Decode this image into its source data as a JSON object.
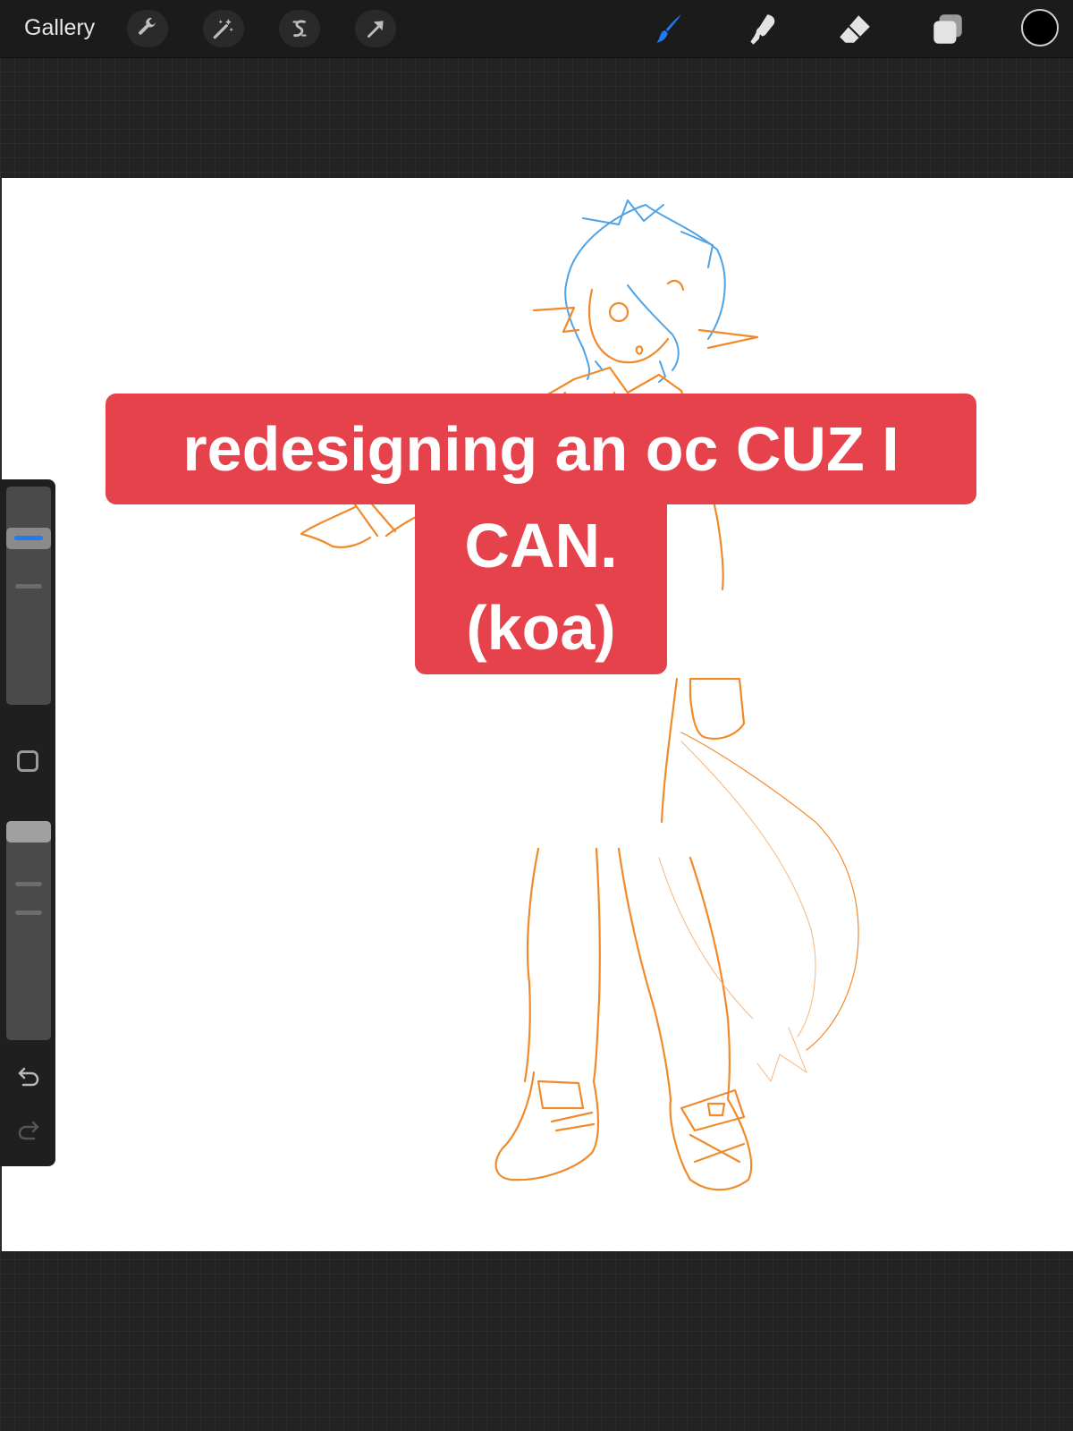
{
  "toolbar": {
    "gallery_label": "Gallery",
    "left_tools": [
      "wrench-icon",
      "magic-wand-icon",
      "selection-icon",
      "transform-arrow-icon"
    ],
    "right_tools": [
      "brush-icon",
      "smudge-icon",
      "eraser-icon",
      "layers-icon"
    ],
    "active_tool": "brush",
    "active_tool_color": "#1f7bf2",
    "current_color": "#000000"
  },
  "caption": {
    "line1": "redesigning an oc CUZ I",
    "line2": "CAN.",
    "line3": "(koa)",
    "background_color": "#e5424b"
  },
  "sidebar": {
    "brush_size_level": 0.79,
    "opacity_level": 1.0,
    "icons": [
      "modify-button",
      "undo-icon",
      "redo-icon"
    ]
  },
  "canvas": {
    "sketch_colors": {
      "body": "#f08a2a",
      "hair": "#4ea3e6"
    }
  }
}
